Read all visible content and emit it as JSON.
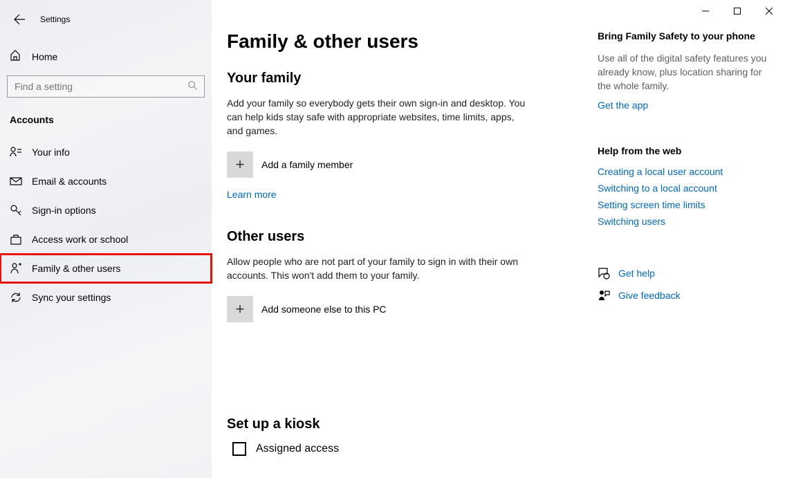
{
  "window": {
    "title": "Settings"
  },
  "sidebar": {
    "home": "Home",
    "search_placeholder": "Find a setting",
    "category": "Accounts",
    "items": [
      {
        "label": "Your info"
      },
      {
        "label": "Email & accounts"
      },
      {
        "label": "Sign-in options"
      },
      {
        "label": "Access work or school"
      },
      {
        "label": "Family & other users"
      },
      {
        "label": "Sync your settings"
      }
    ]
  },
  "main": {
    "title": "Family & other users",
    "family": {
      "heading": "Your family",
      "desc": "Add your family so everybody gets their own sign-in and desktop. You can help kids stay safe with appropriate websites, time limits, apps, and games.",
      "add": "Add a family member",
      "learn_more": "Learn more"
    },
    "other": {
      "heading": "Other users",
      "desc": "Allow people who are not part of your family to sign in with their own accounts. This won't add them to your family.",
      "add": "Add someone else to this PC"
    },
    "kiosk": {
      "heading": "Set up a kiosk",
      "assigned": "Assigned access"
    }
  },
  "right": {
    "family_safety": {
      "heading": "Bring Family Safety to your phone",
      "desc": "Use all of the digital safety features you already know, plus location sharing for the whole family.",
      "link": "Get the app"
    },
    "help": {
      "heading": "Help from the web",
      "links": [
        "Creating a local user account",
        "Switching to a local account",
        "Setting screen time limits",
        "Switching users"
      ]
    },
    "get_help": "Get help",
    "feedback": "Give feedback"
  }
}
